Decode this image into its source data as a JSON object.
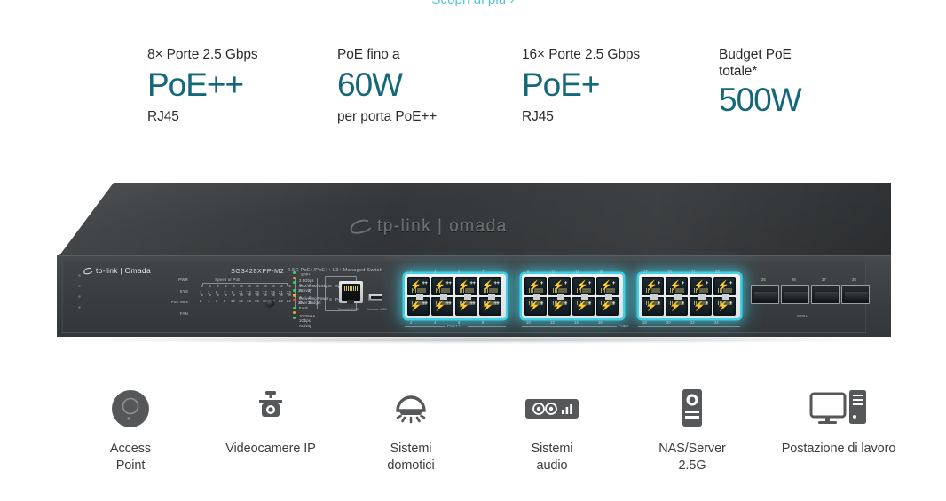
{
  "link": {
    "label": "Scopri di più ›"
  },
  "specs": [
    {
      "top": "8× Porte 2.5 Gbps",
      "big": "PoE++",
      "sub": "RJ45"
    },
    {
      "top": "PoE fino a",
      "big": "60W",
      "sub": "per porta PoE++"
    },
    {
      "top": "16× Porte 2.5 Gbps",
      "big": "PoE+",
      "sub": "RJ45"
    },
    {
      "top": "Budget PoE\ntotale*",
      "big": "500W",
      "sub": ""
    }
  ],
  "device": {
    "top_logo": "tp-link | omada",
    "front_brand": "tp-link | Omada",
    "model": "SG3428XPP-M2",
    "description": "2.5G PoE+/PoE++ L3+ Managed Switch",
    "status_leds": [
      "PWR",
      "SYS",
      "PoE Max",
      "FAN"
    ],
    "led_section_caption": "Speed or PoE",
    "sfp_caption": "SFP+",
    "mode_buttons": [
      "Speed",
      "PoE"
    ],
    "console_rj45_label": "Console RJ45",
    "console_usb_label": "Console USB",
    "led_numbers_row1": [
      "1",
      "3",
      "5",
      "7",
      "9",
      "11",
      "13",
      "15",
      "17",
      "19",
      "21",
      "23"
    ],
    "led_numbers_row2": [
      "2",
      "4",
      "6",
      "8",
      "10",
      "12",
      "14",
      "16",
      "18",
      "20",
      "22",
      "24"
    ],
    "sfp_led_numbers": [
      "25",
      "27",
      "26",
      "28"
    ],
    "legend": [
      {
        "color": "#3fd06a",
        "text": "2.5Gbps"
      },
      {
        "color": "#f0a82c",
        "text": "10M/100M/1Gbps"
      },
      {
        "color": "#3fd06a",
        "text": "Activity"
      },
      {
        "color": "#3fd06a",
        "text": "Delivering Power"
      },
      {
        "color": "#f0a82c",
        "text": "Over Budget"
      },
      {
        "color": "#e2503c",
        "text": "Fault"
      },
      {
        "color": "#3fd06a",
        "text": "10GBase"
      },
      {
        "color": "#f0a82c",
        "text": "1Gbps"
      },
      {
        "color": "#3fd06a",
        "text": "Activity"
      }
    ],
    "port_groups": [
      {
        "label": "PoE++",
        "type": "poe_plus_plus",
        "bolt": "++",
        "numbers_top": [
          "1",
          "3",
          "5",
          "7"
        ],
        "numbers_bottom": [
          "2",
          "4",
          "6",
          "8"
        ]
      },
      {
        "label": "PoE+",
        "type": "poe_plus",
        "bolt": "+",
        "numbers_top": [
          "9",
          "11",
          "13",
          "15"
        ],
        "numbers_bottom": [
          "10",
          "12",
          "14",
          "16"
        ]
      },
      {
        "label": "PoE+",
        "type": "poe_plus",
        "bolt": "+",
        "numbers_top": [
          "17",
          "19",
          "21",
          "23"
        ],
        "numbers_bottom": [
          "18",
          "20",
          "22",
          "24"
        ]
      }
    ],
    "sfp_ports": {
      "label": "SFP+",
      "numbers": [
        "25",
        "26",
        "27",
        "28"
      ]
    }
  },
  "apps": [
    {
      "icon": "access-point-icon",
      "label": "Access\nPoint"
    },
    {
      "icon": "ip-camera-icon",
      "label": "Videocamere IP"
    },
    {
      "icon": "smart-home-icon",
      "label": "Sistemi\ndomotici"
    },
    {
      "icon": "audio-system-icon",
      "label": "Sistemi\naudio"
    },
    {
      "icon": "nas-server-icon",
      "label": "NAS/Server\n2.5G"
    },
    {
      "icon": "workstation-icon",
      "label": "Postazione di lavoro"
    }
  ],
  "colors": {
    "accent_teal": "#15677a",
    "link_cyan": "#4ec7dc",
    "glow_cyan": "#3fd0e4",
    "text_dark": "#2b2b2b",
    "icon_gray": "#555759"
  }
}
